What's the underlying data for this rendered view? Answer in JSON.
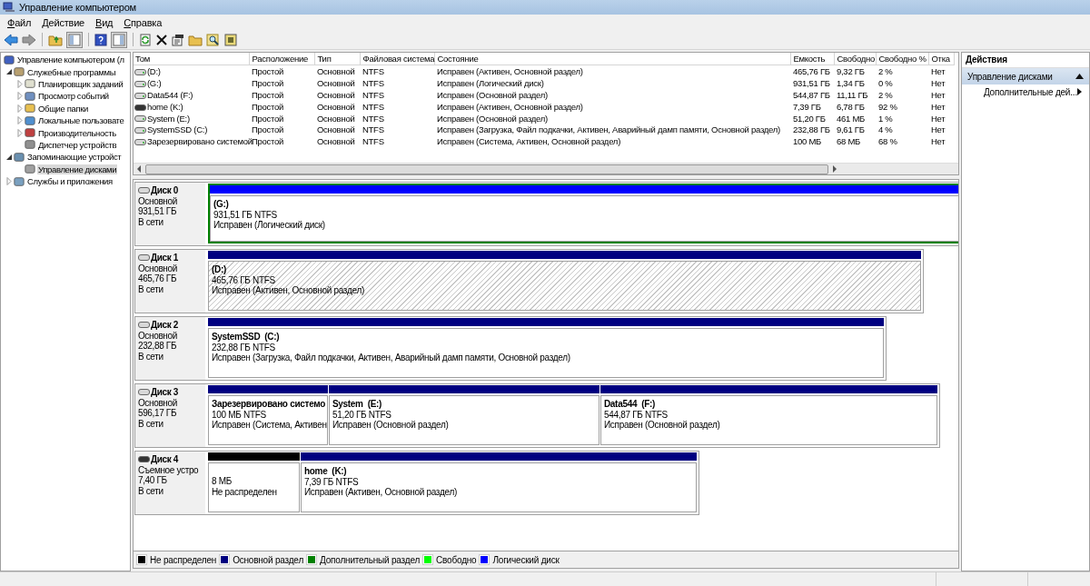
{
  "window": {
    "title": "Управление компьютером"
  },
  "menu": [
    "Файл",
    "Действие",
    "Вид",
    "Справка"
  ],
  "tree": [
    {
      "label": "Управление компьютером (л",
      "selected": false,
      "children": [
        {
          "label": "Служебные программы",
          "expanded": true,
          "selected": false,
          "children": [
            {
              "label": "Планировщик заданий",
              "expanded": false,
              "selected": false
            },
            {
              "label": "Просмотр событий",
              "expanded": false,
              "selected": false
            },
            {
              "label": "Общие папки",
              "expanded": false,
              "selected": false
            },
            {
              "label": "Локальные пользовате",
              "expanded": false,
              "selected": false
            },
            {
              "label": "Производительность",
              "expanded": false,
              "selected": false
            },
            {
              "label": "Диспетчер устройств",
              "selected": false
            }
          ]
        },
        {
          "label": "Запоминающие устройст",
          "expanded": true,
          "selected": false,
          "children": [
            {
              "label": "Управление дисками",
              "selected": true
            }
          ]
        },
        {
          "label": "Службы и приложения",
          "expanded": false,
          "selected": false
        }
      ]
    }
  ],
  "table": {
    "columns": [
      "Том",
      "Расположение",
      "Тип",
      "Файловая система",
      "Состояние",
      "Емкость",
      "Свободно",
      "Свободно %",
      "Отка"
    ],
    "rows": [
      {
        "kind": "fixed",
        "cells": [
          "(D:)",
          "Простой",
          "Основной",
          "NTFS",
          "Исправен (Активен, Основной раздел)",
          "465,76 ГБ",
          "9,32 ГБ",
          "2 %",
          "Нет"
        ]
      },
      {
        "kind": "fixed",
        "cells": [
          "(G:)",
          "Простой",
          "Основной",
          "NTFS",
          "Исправен (Логический диск)",
          "931,51 ГБ",
          "1,34 ГБ",
          "0 %",
          "Нет"
        ]
      },
      {
        "kind": "fixed",
        "cells": [
          "Data544 (F:)",
          "Простой",
          "Основной",
          "NTFS",
          "Исправен (Основной раздел)",
          "544,87 ГБ",
          "11,11 ГБ",
          "2 %",
          "Нет"
        ]
      },
      {
        "kind": "removable",
        "cells": [
          "home (K:)",
          "Простой",
          "Основной",
          "NTFS",
          "Исправен (Активен, Основной раздел)",
          "7,39 ГБ",
          "6,78 ГБ",
          "92 %",
          "Нет"
        ]
      },
      {
        "kind": "fixed",
        "cells": [
          "System (E:)",
          "Простой",
          "Основной",
          "NTFS",
          "Исправен (Основной раздел)",
          "51,20 ГБ",
          "461 МБ",
          "1 %",
          "Нет"
        ]
      },
      {
        "kind": "fixed",
        "cells": [
          "SystemSSD (C:)",
          "Простой",
          "Основной",
          "NTFS",
          "Исправен (Загрузка, Файл подкачки, Активен, Аварийный дамп памяти, Основной раздел)",
          "232,88 ГБ",
          "9,61 ГБ",
          "4 %",
          "Нет"
        ]
      },
      {
        "kind": "fixed",
        "cells": [
          "Зарезервировано системой",
          "Простой",
          "Основной",
          "NTFS",
          "Исправен (Система, Активен, Основной раздел)",
          "100 МБ",
          "68 МБ",
          "68 %",
          "Нет"
        ]
      }
    ]
  },
  "disks": [
    {
      "kind": "fixed",
      "name": "Диск 0",
      "type": "Основной",
      "size": "931,51 ГБ",
      "status": "В сети",
      "partitions": [
        {
          "kind": "logical",
          "extended": true,
          "selected": false,
          "name": "(G:)",
          "size": "931,51 ГБ NTFS",
          "status": "Исправен (Логический диск)"
        }
      ]
    },
    {
      "kind": "fixed",
      "name": "Диск 1",
      "type": "Основной",
      "size": "465,76 ГБ",
      "status": "В сети",
      "partitions": [
        {
          "kind": "primary",
          "extended": false,
          "selected": true,
          "name": "(D:)",
          "size": "465,76 ГБ NTFS",
          "status": "Исправен (Активен, Основной раздел)"
        }
      ]
    },
    {
      "kind": "fixed",
      "name": "Диск 2",
      "type": "Основной",
      "size": "232,88 ГБ",
      "status": "В сети",
      "partitions": [
        {
          "kind": "primary",
          "extended": false,
          "selected": false,
          "name": "SystemSSD  (C:)",
          "size": "232,88 ГБ NTFS",
          "status": "Исправен (Загрузка, Файл подкачки, Активен, Аварийный дамп памяти, Основной раздел)"
        }
      ]
    },
    {
      "kind": "fixed",
      "name": "Диск 3",
      "type": "Основной",
      "size": "596,17 ГБ",
      "status": "В сети",
      "partitions": [
        {
          "kind": "primary",
          "extended": false,
          "selected": false,
          "name": "Зарезервировано системо",
          "size": "100 МБ NTFS",
          "status": "Исправен (Система, Активен"
        },
        {
          "kind": "primary",
          "extended": false,
          "selected": false,
          "name": "System  (E:)",
          "size": "51,20 ГБ NTFS",
          "status": "Исправен (Основной раздел)"
        },
        {
          "kind": "primary",
          "extended": false,
          "selected": false,
          "name": "Data544  (F:)",
          "size": "544,87 ГБ NTFS",
          "status": "Исправен (Основной раздел)"
        }
      ]
    },
    {
      "kind": "removable",
      "name": "Диск 4",
      "type": "Съемное устро",
      "size": "7,40 ГБ",
      "status": "В сети",
      "partitions": [
        {
          "kind": "unallocated",
          "extended": false,
          "selected": false,
          "size": "8 МБ",
          "status": "Не распределен"
        },
        {
          "kind": "primary",
          "extended": false,
          "selected": false,
          "name": "home  (K:)",
          "size": "7,39 ГБ NTFS",
          "status": "Исправен (Активен, Основной раздел)"
        }
      ]
    }
  ],
  "legend": [
    {
      "label": "Не распределен",
      "color": "#000000"
    },
    {
      "label": "Основной раздел",
      "color": "#000080"
    },
    {
      "label": "Дополнительный раздел",
      "color": "#008000"
    },
    {
      "label": "Свободно",
      "color": "#00ff00"
    },
    {
      "label": "Логический диск",
      "color": "#0000ff"
    }
  ],
  "actions": {
    "title": "Действия",
    "section": {
      "label": "Управление дисками",
      "expanded": true
    },
    "items": [
      "Дополнительные дей..."
    ]
  }
}
